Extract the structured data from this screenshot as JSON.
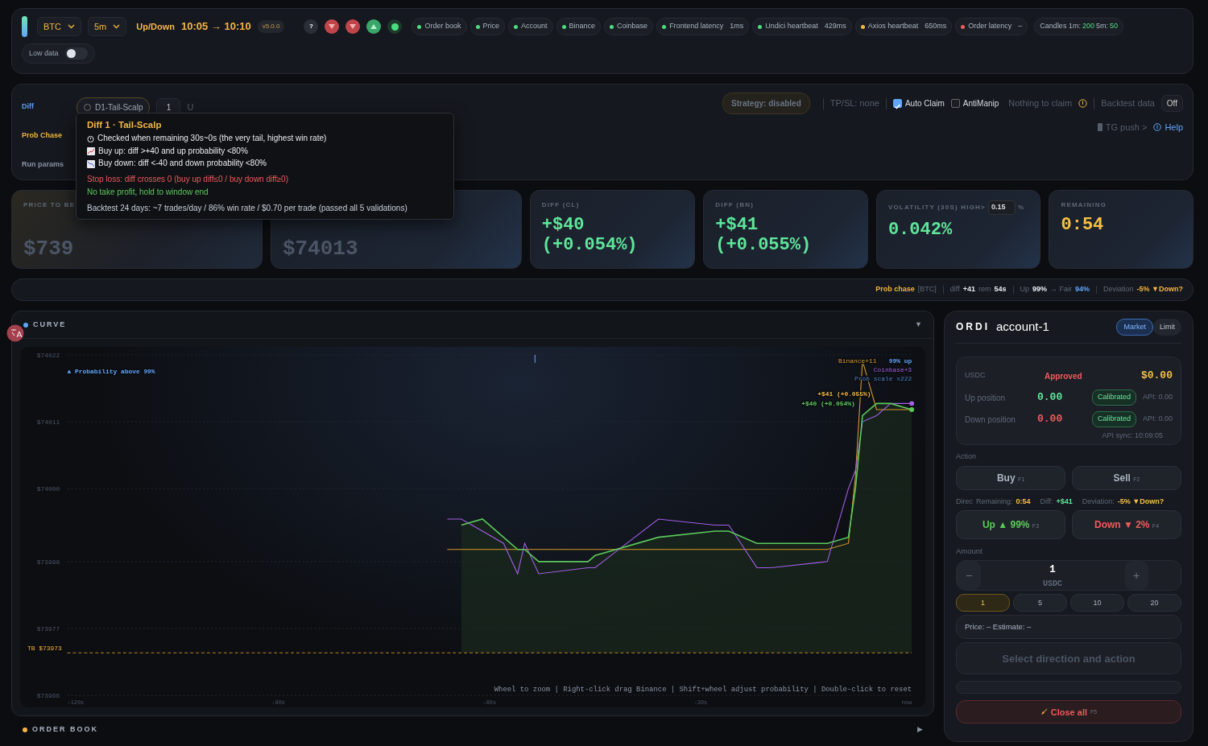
{
  "header": {
    "symbol": "BTC",
    "interval": "5m",
    "market": "Up/Down",
    "window": "10:05 → 10:10",
    "version": "v5.0.0",
    "icon_buttons": [
      {
        "kind": "help",
        "label": "?"
      },
      {
        "kind": "down"
      },
      {
        "kind": "down"
      },
      {
        "kind": "up"
      },
      {
        "kind": "dot"
      }
    ],
    "statuses": [
      {
        "label": "Order book",
        "color": "#4ade80"
      },
      {
        "label": "Price",
        "color": "#4ade80"
      },
      {
        "label": "Account",
        "color": "#4ade80"
      },
      {
        "label": "Binance",
        "color": "#4ade80"
      },
      {
        "label": "Coinbase",
        "color": "#4ade80"
      },
      {
        "label": "Frontend latency",
        "value": "1ms",
        "color": "#4ade80"
      },
      {
        "label": "Undici heartbeat",
        "value": "429ms",
        "color": "#4ade80"
      },
      {
        "label": "Axios heartbeat",
        "value": "650ms",
        "color": "#f5b544"
      },
      {
        "label": "Order latency",
        "value": "–",
        "color": "#ef5b5b"
      }
    ],
    "candles": {
      "prefix": "Candles 1m:",
      "m1": "200",
      "m5_label": "5m:",
      "m5": "50"
    },
    "low_data": {
      "label": "Low data",
      "on": false
    }
  },
  "strategy": {
    "rows": [
      {
        "label": "Diff",
        "color": "#5b9cf5"
      },
      {
        "label": "Prob Chase",
        "color": "#f0b43c"
      },
      {
        "label": "Run params",
        "color": "#8a93a3"
      }
    ],
    "chip": {
      "label": "D1-Tail-Scalp",
      "selected": false
    },
    "quantity": "1",
    "unit": "U",
    "status": "Strategy: disabled",
    "tpsl": "TP/SL: none",
    "checks": [
      {
        "label": "Auto Claim",
        "checked": true
      },
      {
        "label": "AntiManip",
        "checked": false
      }
    ],
    "claim": "Nothing to claim",
    "backtest": {
      "label": "Backtest data",
      "value": "Off"
    },
    "tg_push": "TG push >",
    "help": "Help"
  },
  "tooltip": {
    "title": "Diff 1 · Tail-Scalp",
    "lines": [
      {
        "kind": "timer",
        "text": "Checked when remaining 30s~0s (the very tail, highest win rate)"
      },
      {
        "kind": "up",
        "text": "Buy up: diff >+40 and up probability <80%"
      },
      {
        "kind": "down",
        "text": "Buy down: diff <-40 and down probability <80%"
      },
      {
        "kind": "loss",
        "text": "Stop loss: diff crosses 0 (buy up diff≤0 / buy down diff≥0)"
      },
      {
        "kind": "profit",
        "text": "No take profit, hold to window end"
      },
      {
        "kind": "note",
        "text": "Backtest 24 days: ~7 trades/day / 86% win rate / $0.70 per trade (passed all 5 validations)"
      }
    ]
  },
  "cards": [
    {
      "kind": "price",
      "label": "PRICE TO BE",
      "value": "$739",
      "color": "#4b5566"
    },
    {
      "kind": "price",
      "value": "$74013",
      "color": "#4b5566"
    },
    {
      "kind": "stat",
      "label": "DIFF (CL)",
      "value": "+$40",
      "sub": "(+0.054%)",
      "color": "#5ee59a"
    },
    {
      "kind": "stat",
      "label": "DIFF (BN)",
      "value": "+$41",
      "sub": "(+0.055%)",
      "color": "#5ee59a"
    },
    {
      "kind": "stat",
      "label": "VOLATILITY (30S) HIGH>",
      "input": "0.15",
      "unit": "%",
      "value": "0.042%",
      "color": "#5ee59a"
    },
    {
      "kind": "stat",
      "label": "REMAINING",
      "value": "0:54",
      "color": "#f5c044"
    }
  ],
  "prob_bar": [
    {
      "kind": "title",
      "text": "Prob chase"
    },
    {
      "kind": "muted",
      "text": "[BTC]",
      "sep": true
    },
    {
      "kind": "muted",
      "text": "diff"
    },
    {
      "kind": "value",
      "text": "+41"
    },
    {
      "kind": "muted",
      "text": "rem"
    },
    {
      "kind": "value",
      "text": "54s",
      "sep": true
    },
    {
      "kind": "muted",
      "text": "Up"
    },
    {
      "kind": "value",
      "text": "99%"
    },
    {
      "kind": "muted",
      "text": "→ Fair"
    },
    {
      "kind": "blue",
      "text": "94%",
      "sep": true
    },
    {
      "kind": "muted",
      "text": "Deviation"
    },
    {
      "kind": "warn",
      "text": "-5% ▼Down?"
    }
  ],
  "curve": {
    "title": "CURVE",
    "toggle": "▼",
    "hint": "Wheel to zoom | Right-click drag Binance | Shift+wheel adjust probability | Double-click to reset",
    "chart_data": {
      "type": "line",
      "grid": true,
      "x": [
        -66,
        -64,
        -61,
        -58,
        -56,
        -55,
        -53,
        -46,
        -45,
        -36,
        -28,
        -26,
        -22,
        -20,
        -12,
        -9,
        -8,
        -7,
        -5,
        -3,
        0
      ],
      "series": [
        {
          "name": "Binance",
          "color": "#d99a2b",
          "values": [
            73990,
            73990,
            73990,
            73990,
            73990,
            73990,
            73990,
            73990,
            73990,
            73990,
            73990,
            73990,
            73990,
            73990,
            73990,
            73991,
            74002,
            74021,
            74013,
            74013,
            74013
          ]
        },
        {
          "name": "Coinbase",
          "color": "#a35ee8",
          "values": [
            73995,
            73995,
            73993,
            73991,
            73986,
            73991,
            73986,
            73987,
            73987,
            73995,
            73994,
            73994,
            73987,
            73987,
            73988,
            74000,
            74003,
            74011,
            74012,
            74014,
            74014
          ]
        },
        {
          "color": "#5cc85c",
          "values": [
            null,
            73994,
            73995,
            73992,
            73990,
            73990,
            73988,
            73988,
            73989,
            73992,
            73993,
            73993,
            73991,
            73991,
            73991,
            73992,
            74000,
            74012,
            74014,
            74014,
            74013
          ]
        }
      ],
      "xlim": [
        -120,
        0
      ],
      "ylim": [
        73966,
        74022
      ],
      "xticks": [
        {
          "value": -120,
          "label": "-120s"
        },
        {
          "value": -90,
          "label": "-90s"
        },
        {
          "value": -60,
          "label": "-60s"
        },
        {
          "value": -30,
          "label": "-30s"
        },
        {
          "value": 0,
          "label": "now"
        }
      ],
      "yticks": [
        {
          "value": 73966,
          "label": "$73966"
        },
        {
          "value": 73977,
          "label": "$73977"
        },
        {
          "value": 73988,
          "label": "$73988"
        },
        {
          "value": 74000,
          "label": "$74000"
        },
        {
          "value": 74011,
          "label": "$74011"
        },
        {
          "value": 74022,
          "label": "$74022"
        }
      ],
      "ref_lines": [
        {
          "axis": "y",
          "value": 73973,
          "label": "TB $73973"
        }
      ],
      "annotations": [
        "▲ Probability above 99%",
        "+11",
        "99% up",
        "+3",
        "Prob scale x222",
        "+$41 (+0.055%)",
        "+$40 (+0.054%)"
      ]
    }
  },
  "order_book": {
    "title": "ORDER BOOK",
    "toggle": "▶"
  },
  "order_panel": {
    "brand": "ORDI",
    "account": "account-1",
    "modes": [
      {
        "label": "Market",
        "selected": true
      },
      {
        "label": "Limit",
        "selected": false
      }
    ],
    "usdc_label": "USDC",
    "approval": "Approved",
    "usdc": "$0.00",
    "positions": [
      {
        "label": "Up position",
        "value": "0.00",
        "kind": "up",
        "status": "Calibrated",
        "api": "API: 0.00"
      },
      {
        "label": "Down position",
        "value": "0.00",
        "kind": "down",
        "status": "Calibrated",
        "api": "API: 0.00"
      }
    ],
    "api_sync": "API sync: 10:09:05",
    "action_label": "Action",
    "actions": [
      {
        "label": "Buy",
        "key": "F1"
      },
      {
        "label": "Sell",
        "key": "F2"
      }
    ],
    "info": [
      {
        "kind": "muted",
        "text": "Direc"
      },
      {
        "kind": "muted",
        "text": "Remaining:"
      },
      {
        "kind": "warn",
        "text": "0:54"
      },
      {
        "kind": "muted",
        "text": "Diff:"
      },
      {
        "kind": "up",
        "text": "+$41"
      },
      {
        "kind": "muted",
        "text": "Deviation:"
      },
      {
        "kind": "warn",
        "text": "-5% ▼Down?"
      }
    ],
    "directions": [
      {
        "label": "Up ▲ 99%",
        "key": "F3",
        "kind": "up"
      },
      {
        "label": "Down ▼ 2%",
        "key": "F4",
        "kind": "down"
      }
    ],
    "amount_label": "Amount",
    "minus": "−",
    "plus": "+",
    "amount": "1",
    "amount_unit": "USDC",
    "presets": [
      {
        "label": "1",
        "selected": true
      },
      {
        "label": "5",
        "selected": false
      },
      {
        "label": "10",
        "selected": false
      },
      {
        "label": "20",
        "selected": false
      }
    ],
    "price": "Price: –  Estimate: –",
    "submit": "Select direction and action",
    "close_all": {
      "label": "Close all",
      "key": "F5"
    }
  }
}
